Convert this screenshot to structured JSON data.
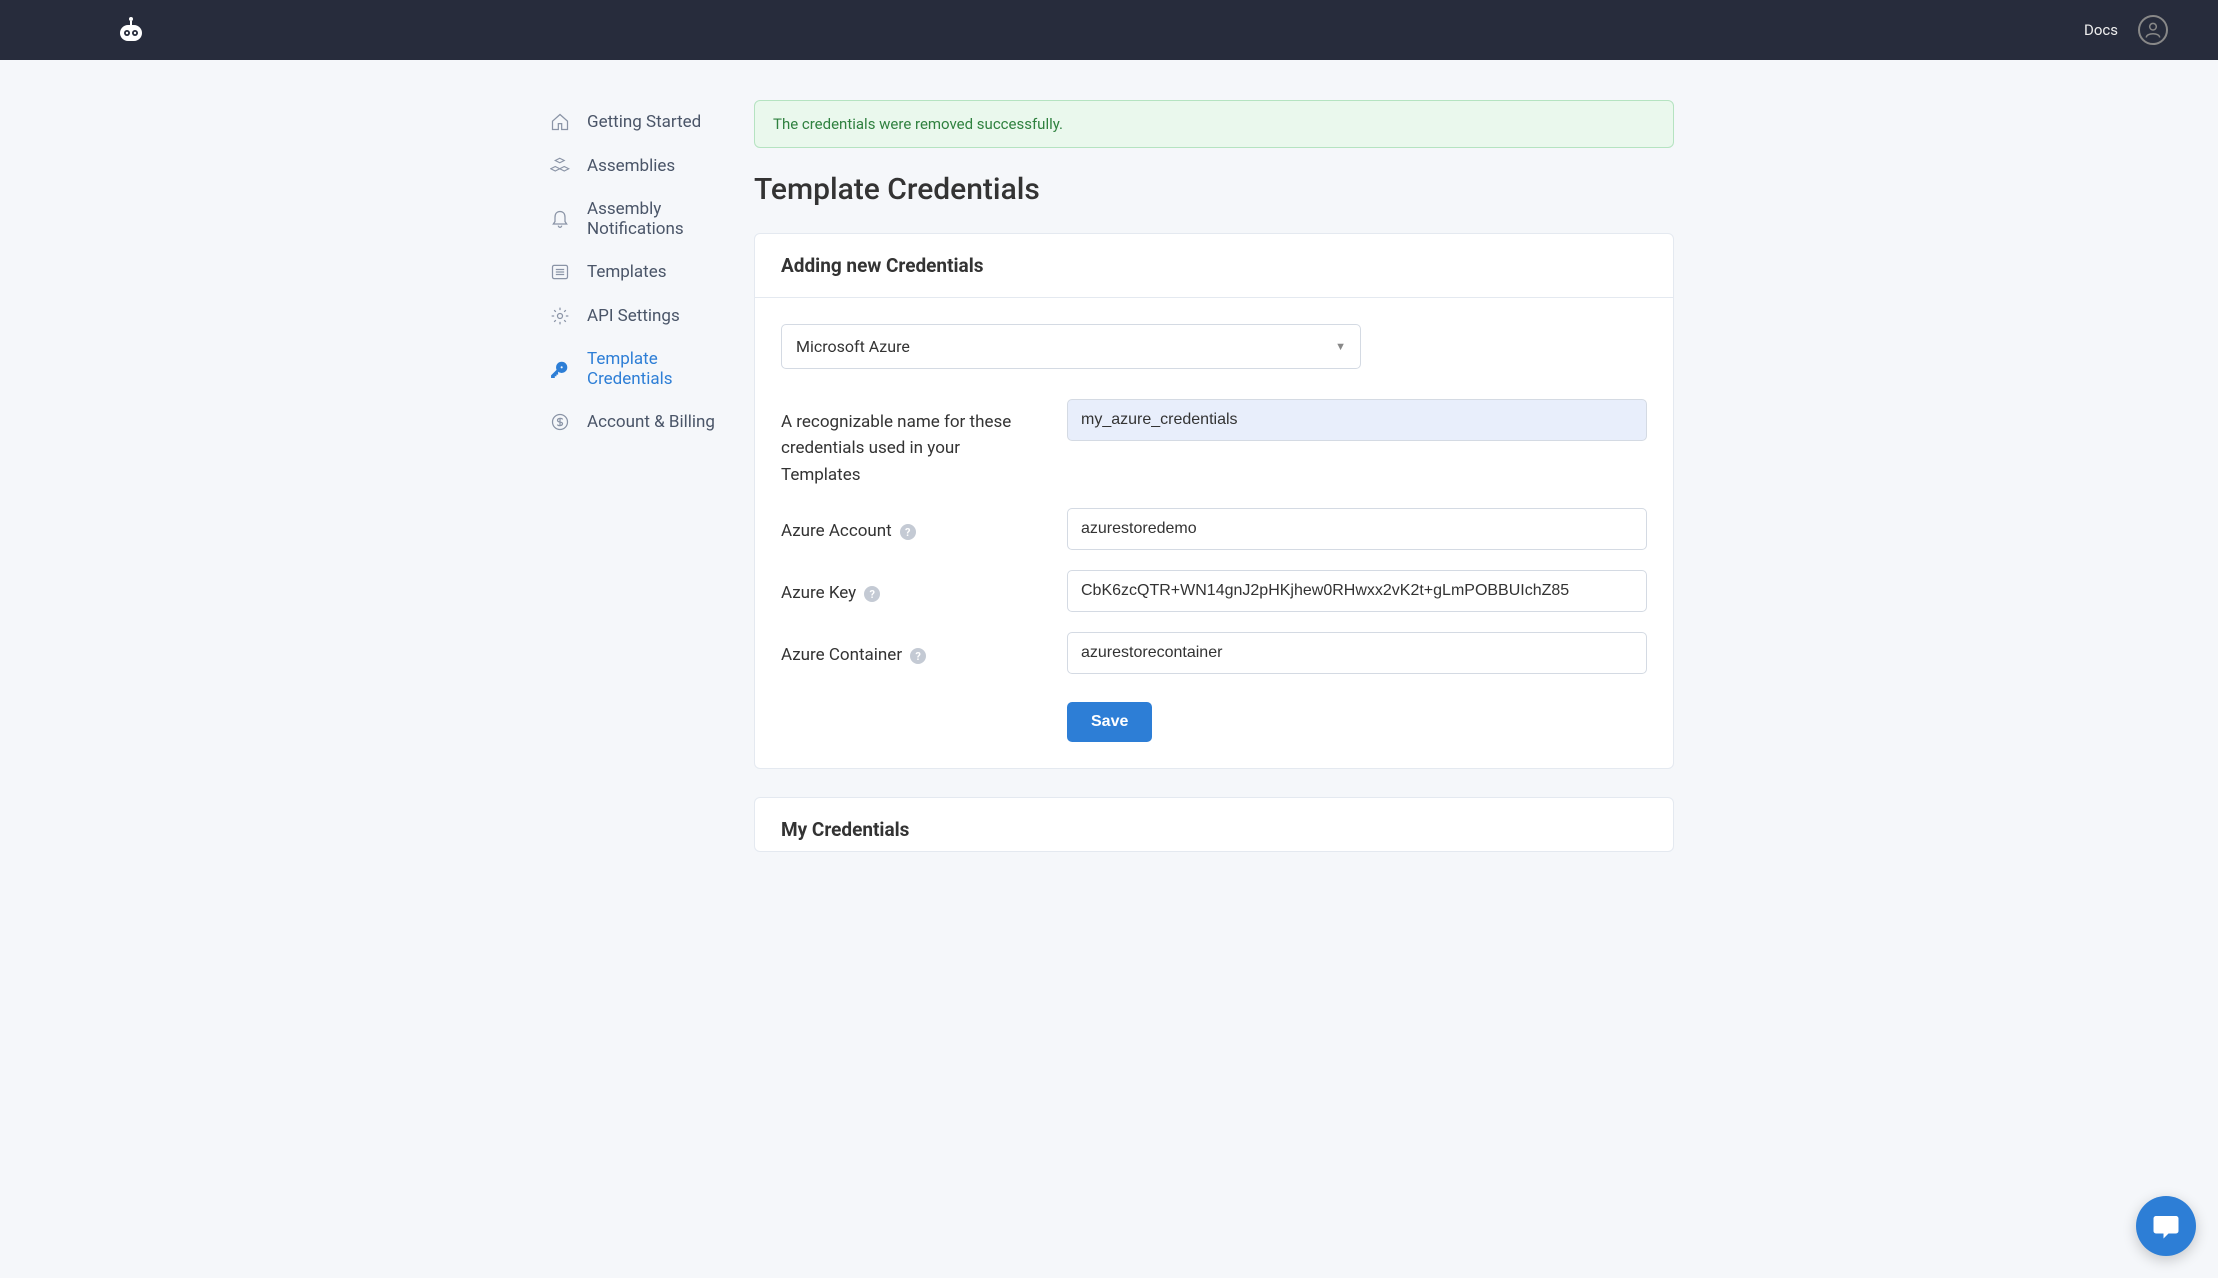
{
  "topbar": {
    "docs_label": "Docs"
  },
  "sidebar": {
    "items": [
      {
        "label": "Getting Started",
        "icon": "home",
        "active": false
      },
      {
        "label": "Assemblies",
        "icon": "cubes",
        "active": false
      },
      {
        "label": "Assembly Notifications",
        "icon": "bell",
        "active": false
      },
      {
        "label": "Templates",
        "icon": "list",
        "active": false
      },
      {
        "label": "API Settings",
        "icon": "gear",
        "active": false
      },
      {
        "label": "Template Credentials",
        "icon": "key",
        "active": true
      },
      {
        "label": "Account & Billing",
        "icon": "dollar",
        "active": false
      }
    ]
  },
  "alert": {
    "message": "The credentials were removed successfully."
  },
  "page": {
    "title": "Template Credentials"
  },
  "form_card": {
    "title": "Adding new Credentials",
    "provider_select": {
      "value": "Microsoft Azure"
    },
    "fields": {
      "name": {
        "label": "A recognizable name for these credentials used in your Templates",
        "value": "my_azure_credentials"
      },
      "account": {
        "label": "Azure Account",
        "value": "azurestoredemo"
      },
      "key": {
        "label": "Azure Key",
        "value": "CbK6zcQTR+WN14gnJ2pHKjhew0RHwxx2vK2t+gLmPOBBUIchZ85"
      },
      "container": {
        "label": "Azure Container",
        "value": "azurestorecontainer"
      }
    },
    "save_label": "Save"
  },
  "second_card": {
    "title": "My Credentials"
  },
  "help_glyph": "?"
}
